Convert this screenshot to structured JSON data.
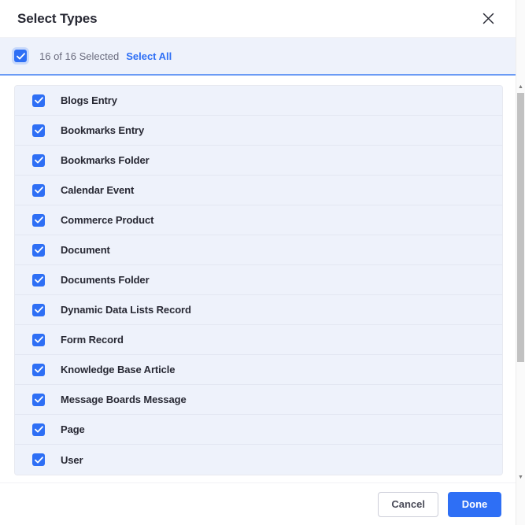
{
  "dialog": {
    "title": "Select Types",
    "close_icon": "close-icon"
  },
  "select_all_bar": {
    "checkbox_icon": "checkmark-icon",
    "count_label": "16 of 16 Selected",
    "select_all_label": "Select All",
    "checked": true
  },
  "list": {
    "items": [
      {
        "label": "Blogs Entry",
        "checked": true
      },
      {
        "label": "Bookmarks Entry",
        "checked": true
      },
      {
        "label": "Bookmarks Folder",
        "checked": true
      },
      {
        "label": "Calendar Event",
        "checked": true
      },
      {
        "label": "Commerce Product",
        "checked": true
      },
      {
        "label": "Document",
        "checked": true
      },
      {
        "label": "Documents Folder",
        "checked": true
      },
      {
        "label": "Dynamic Data Lists Record",
        "checked": true
      },
      {
        "label": "Form Record",
        "checked": true
      },
      {
        "label": "Knowledge Base Article",
        "checked": true
      },
      {
        "label": "Message Boards Message",
        "checked": true
      },
      {
        "label": "Page",
        "checked": true
      },
      {
        "label": "User",
        "checked": true
      }
    ]
  },
  "footer": {
    "cancel_label": "Cancel",
    "done_label": "Done"
  },
  "scrollbar": {
    "up_arrow": "chevron-up-icon",
    "down_arrow": "chevron-down-icon"
  },
  "colors": {
    "accent": "#2e6ff5",
    "row_bg": "#eef2fb",
    "text": "#272833",
    "muted_text": "#6b6c7e",
    "divider_blue": "#6b9bf5"
  }
}
